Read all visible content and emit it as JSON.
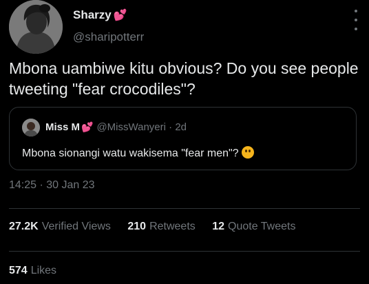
{
  "author": {
    "name": "Sharzy",
    "name_emoji": "💕",
    "handle": "@sharipotterr"
  },
  "tweet": {
    "text": "Mbona uambiwe kitu obvious? Do you see people tweeting \"fear crocodiles\"?"
  },
  "quoted_tweet": {
    "name": "Miss M",
    "name_emoji": "💕",
    "handle": "@MissWanyeri",
    "separator": "·",
    "time": "2d",
    "text": "Mbona sionangi watu wakisema \"fear men\"?",
    "emoji_icon": "thinking-face-icon"
  },
  "meta": {
    "timestamp": "14:25 · 30 Jan 23"
  },
  "stats": {
    "views_count": "27.2K",
    "views_label": "Verified Views",
    "retweets_count": "210",
    "retweets_label": "Retweets",
    "quotes_count": "12",
    "quotes_label": "Quote Tweets",
    "likes_count": "574",
    "likes_label": "Likes"
  },
  "colors": {
    "background": "#000000",
    "primary_text": "#e7e9ea",
    "secondary_text": "#71767b",
    "border": "#2f3336",
    "heart": "#e0245e"
  }
}
